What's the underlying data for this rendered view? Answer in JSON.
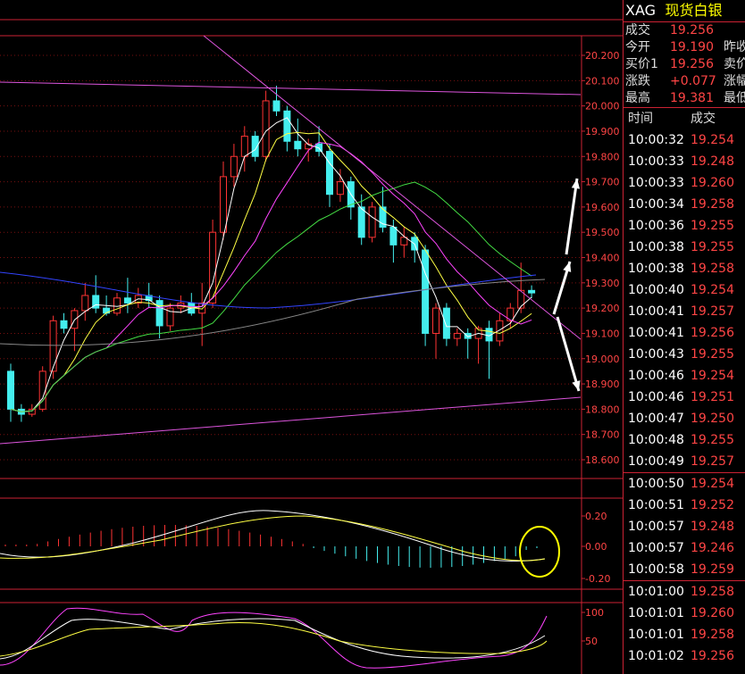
{
  "header": {
    "symbol": "XAG",
    "name": "现货白银"
  },
  "quote": [
    {
      "label": "成交",
      "value": "19.256",
      "right": ""
    },
    {
      "label": "今开",
      "value": "19.190",
      "right": "昨收"
    },
    {
      "label": "买价1",
      "value": "19.256",
      "right": "卖价"
    },
    {
      "label": "涨跌",
      "value": "+0.077",
      "right": "涨幅"
    },
    {
      "label": "最高",
      "value": "19.381",
      "right": "最低"
    }
  ],
  "ticks_header": {
    "time": "时间",
    "price": "成交"
  },
  "ticks": [
    {
      "time": "10:00:32",
      "price": "19.254"
    },
    {
      "time": "10:00:33",
      "price": "19.248"
    },
    {
      "time": "10:00:33",
      "price": "19.260"
    },
    {
      "time": "10:00:34",
      "price": "19.258"
    },
    {
      "time": "10:00:36",
      "price": "19.255"
    },
    {
      "time": "10:00:38",
      "price": "19.255"
    },
    {
      "time": "10:00:38",
      "price": "19.258"
    },
    {
      "time": "10:00:40",
      "price": "19.254"
    },
    {
      "time": "10:00:41",
      "price": "19.257"
    },
    {
      "time": "10:00:41",
      "price": "19.256"
    },
    {
      "time": "10:00:43",
      "price": "19.255"
    },
    {
      "time": "10:00:46",
      "price": "19.254"
    },
    {
      "time": "10:00:46",
      "price": "19.251"
    },
    {
      "time": "10:00:47",
      "price": "19.250"
    },
    {
      "time": "10:00:48",
      "price": "19.255"
    },
    {
      "time": "10:00:49",
      "price": "19.257"
    },
    {
      "time": "10:00:50",
      "price": "19.254"
    },
    {
      "time": "10:00:51",
      "price": "19.252"
    },
    {
      "time": "10:00:57",
      "price": "19.248"
    },
    {
      "time": "10:00:57",
      "price": "19.246"
    },
    {
      "time": "10:00:58",
      "price": "19.259"
    },
    {
      "time": "10:01:00",
      "price": "19.258"
    },
    {
      "time": "10:01:01",
      "price": "19.260"
    },
    {
      "time": "10:01:01",
      "price": "19.258"
    },
    {
      "time": "10:01:02",
      "price": "19.256"
    }
  ],
  "colors": {
    "up": "#ff3333",
    "down": "#44eeee",
    "grid": "#7a1010",
    "axis_text": "#ff4545"
  },
  "price_axis": {
    "labels": [
      "20.200",
      "20.100",
      "20.000",
      "19.900",
      "19.800",
      "19.700",
      "19.600",
      "19.500",
      "19.400",
      "19.300",
      "19.200",
      "19.100",
      "19.000",
      "18.900",
      "18.800",
      "18.700",
      "18.600"
    ],
    "min": 18.6,
    "max": 20.2
  },
  "macd_axis": {
    "labels": [
      "0.20",
      "0.00",
      "-0.20"
    ]
  },
  "kdj_axis": {
    "labels": [
      "100",
      "50"
    ]
  },
  "chart_data": {
    "type": "candlestick",
    "candles": [
      [
        18.95,
        18.98,
        18.75,
        18.8
      ],
      [
        18.8,
        18.82,
        18.75,
        18.78
      ],
      [
        18.78,
        18.82,
        18.77,
        18.8
      ],
      [
        18.8,
        18.97,
        18.79,
        18.95
      ],
      [
        18.95,
        19.17,
        18.92,
        19.15
      ],
      [
        19.15,
        19.18,
        19.1,
        19.12
      ],
      [
        19.12,
        19.2,
        19.03,
        19.19
      ],
      [
        19.19,
        19.3,
        19.15,
        19.25
      ],
      [
        19.25,
        19.33,
        19.18,
        19.2
      ],
      [
        19.2,
        19.25,
        19.17,
        19.18
      ],
      [
        19.18,
        19.26,
        19.17,
        19.24
      ],
      [
        19.24,
        19.32,
        19.18,
        19.22
      ],
      [
        19.22,
        19.28,
        19.2,
        19.25
      ],
      [
        19.25,
        19.3,
        19.2,
        19.23
      ],
      [
        19.23,
        19.25,
        19.08,
        19.13
      ],
      [
        19.13,
        19.22,
        19.11,
        19.2
      ],
      [
        19.2,
        19.25,
        19.18,
        19.22
      ],
      [
        19.22,
        19.26,
        19.17,
        19.18
      ],
      [
        19.18,
        19.3,
        19.05,
        19.22
      ],
      [
        19.22,
        19.55,
        19.2,
        19.5
      ],
      [
        19.5,
        19.78,
        19.47,
        19.72
      ],
      [
        19.72,
        19.85,
        19.68,
        19.8
      ],
      [
        19.8,
        19.92,
        19.74,
        19.88
      ],
      [
        19.88,
        19.9,
        19.78,
        19.8
      ],
      [
        19.8,
        20.06,
        19.78,
        20.02
      ],
      [
        20.02,
        20.08,
        19.96,
        19.98
      ],
      [
        19.98,
        20.0,
        19.82,
        19.86
      ],
      [
        19.86,
        19.95,
        19.8,
        19.83
      ],
      [
        19.83,
        19.87,
        19.78,
        19.85
      ],
      [
        19.85,
        19.92,
        19.8,
        19.82
      ],
      [
        19.82,
        19.85,
        19.6,
        19.65
      ],
      [
        19.65,
        19.75,
        19.62,
        19.7
      ],
      [
        19.7,
        19.72,
        19.55,
        19.6
      ],
      [
        19.6,
        19.65,
        19.45,
        19.48
      ],
      [
        19.48,
        19.62,
        19.46,
        19.6
      ],
      [
        19.6,
        19.68,
        19.5,
        19.52
      ],
      [
        19.52,
        19.55,
        19.38,
        19.45
      ],
      [
        19.45,
        19.52,
        19.4,
        19.48
      ],
      [
        19.48,
        19.5,
        19.38,
        19.43
      ],
      [
        19.43,
        19.45,
        19.05,
        19.1
      ],
      [
        19.1,
        19.22,
        19.0,
        19.2
      ],
      [
        19.2,
        19.22,
        19.05,
        19.08
      ],
      [
        19.08,
        19.12,
        19.05,
        19.1
      ],
      [
        19.1,
        19.12,
        19.0,
        19.08
      ],
      [
        19.08,
        19.13,
        18.98,
        19.12
      ],
      [
        19.12,
        19.15,
        18.92,
        19.07
      ],
      [
        19.07,
        19.18,
        19.05,
        19.15
      ],
      [
        19.15,
        19.22,
        19.12,
        19.2
      ],
      [
        19.2,
        19.38,
        19.18,
        19.27
      ],
      [
        19.27,
        19.29,
        19.24,
        19.26
      ]
    ]
  }
}
